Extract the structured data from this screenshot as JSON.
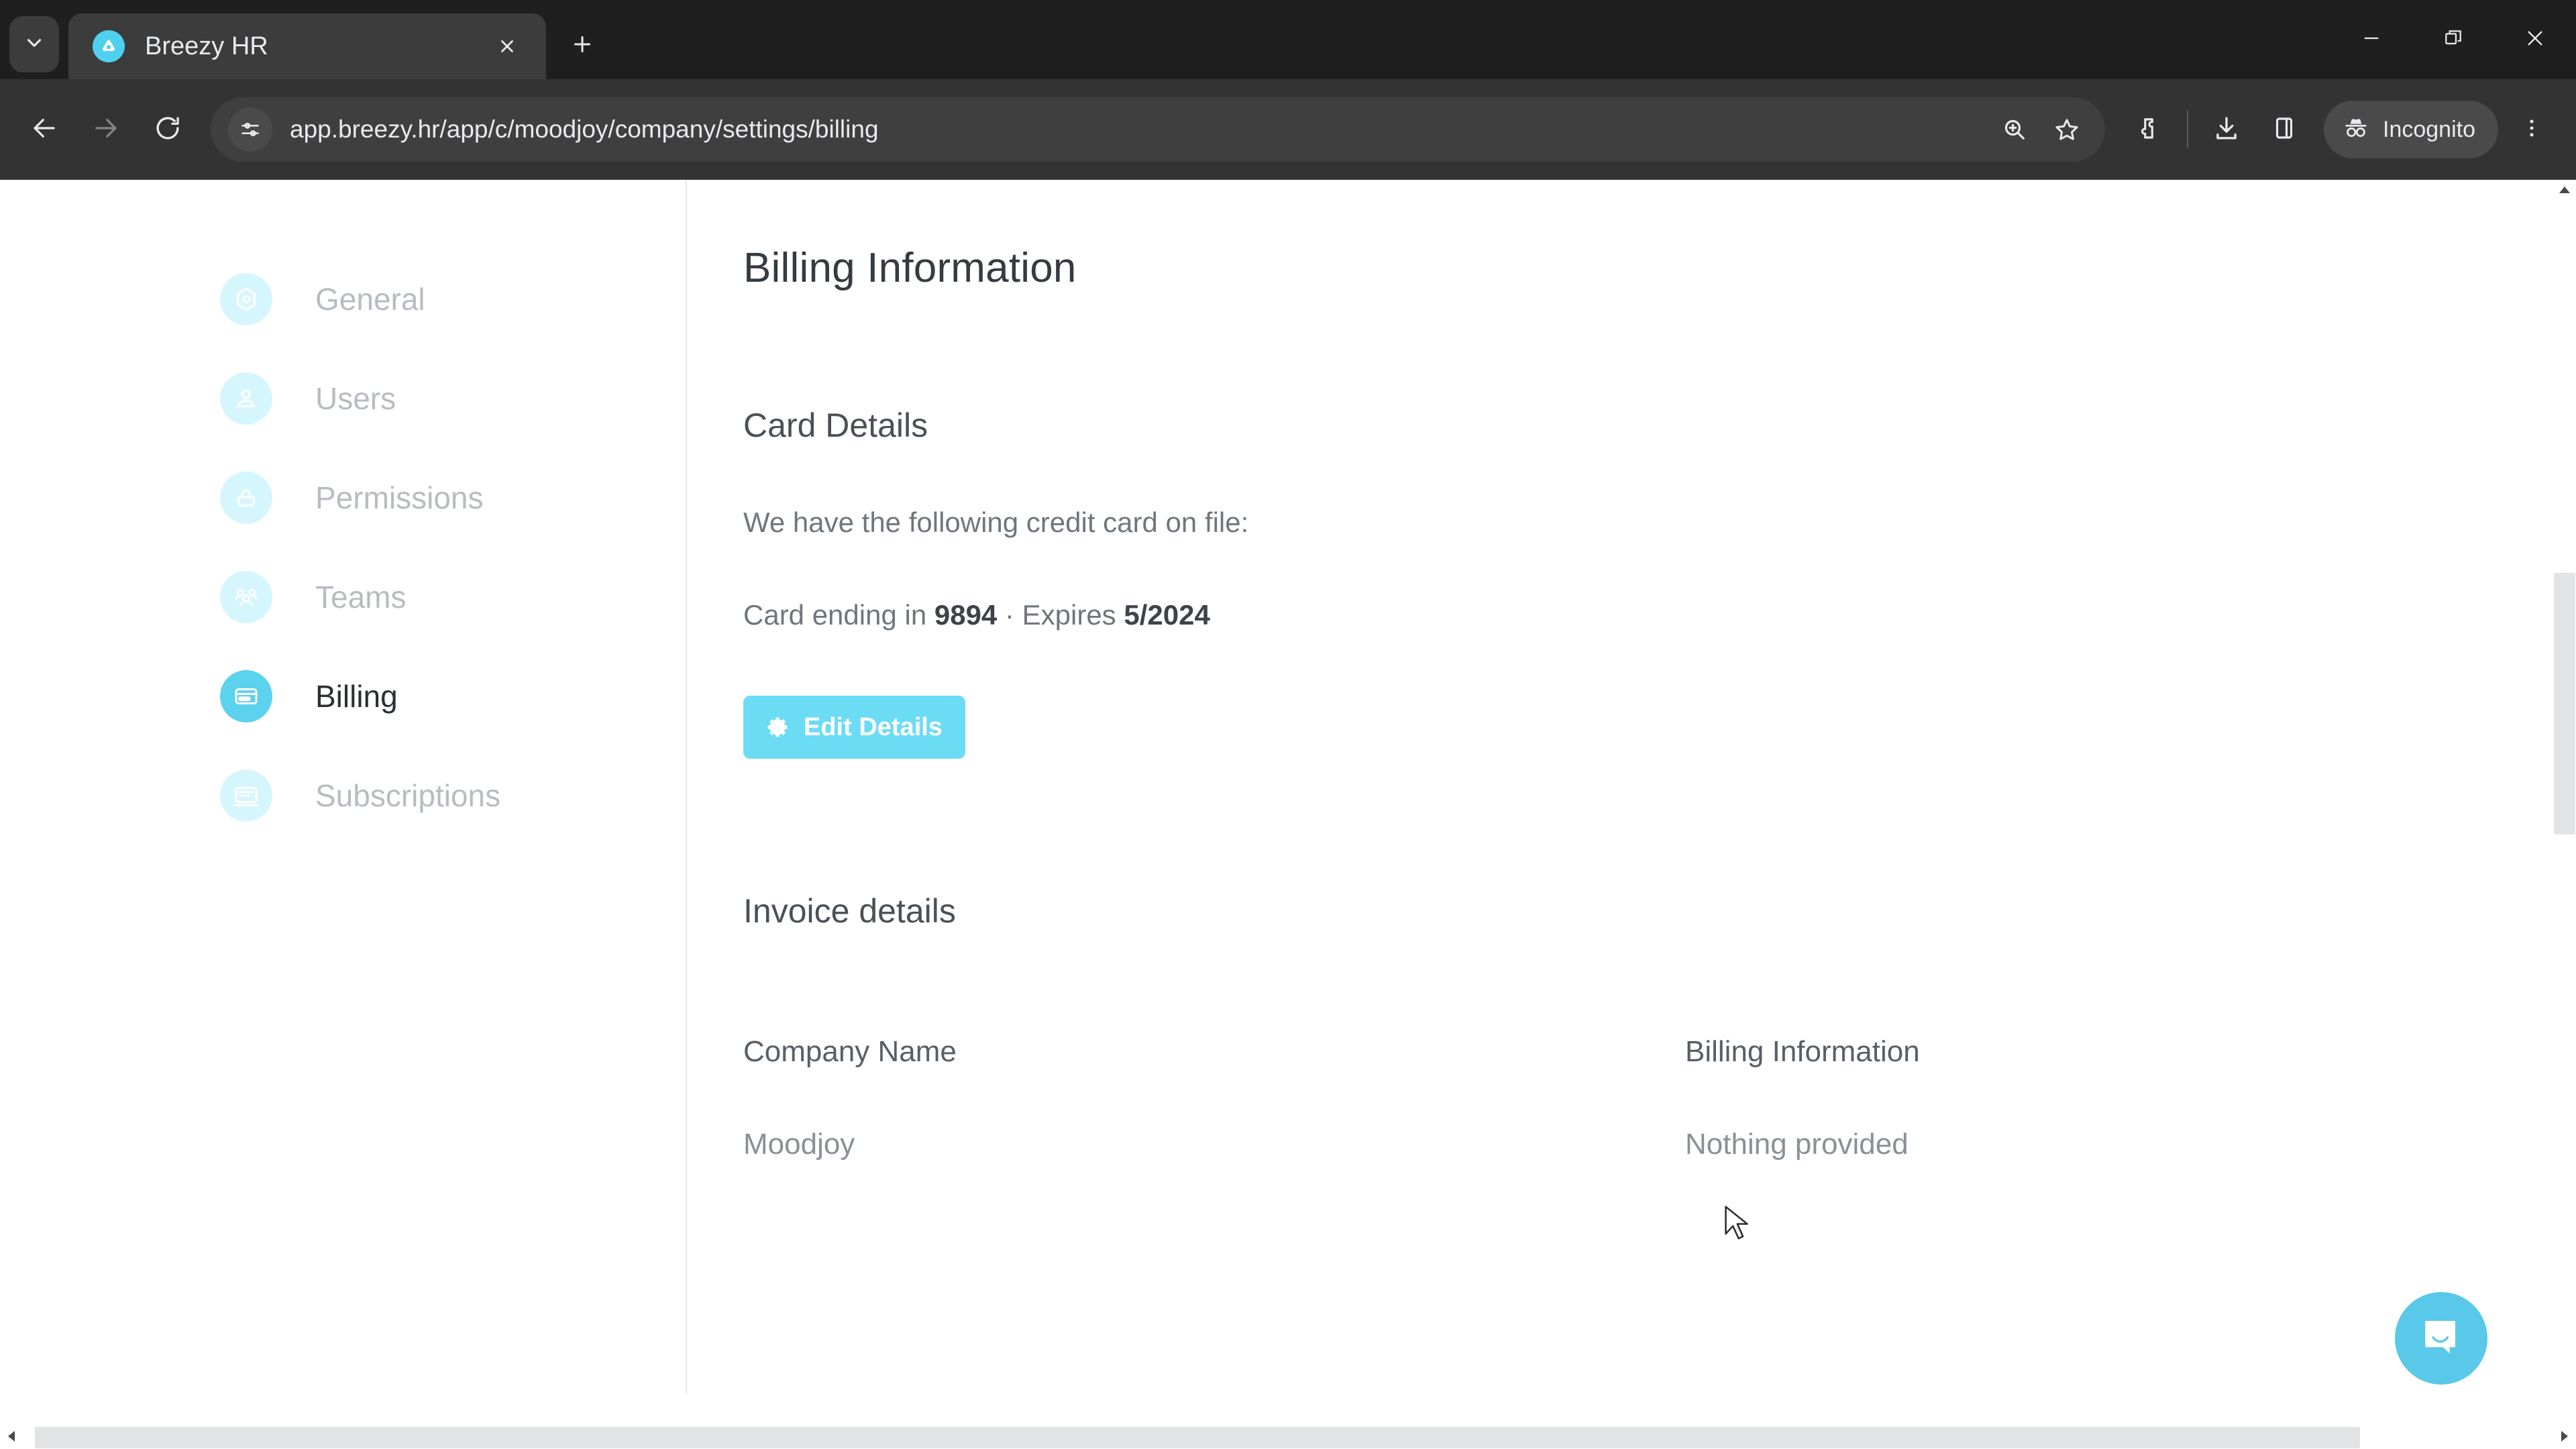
{
  "browser": {
    "tab": {
      "title": "Breezy HR",
      "favicon_name": "breezy-hr-favicon"
    },
    "omnibox": {
      "url": "app.breezy.hr/app/c/moodjoy/company/settings/billing",
      "site_info_icon": "tune-icon"
    },
    "toolbar_icons": {
      "back": "back-arrow-icon",
      "forward": "forward-arrow-icon",
      "reload": "reload-icon",
      "zoom": "zoom-search-icon",
      "bookmark": "star-icon",
      "extensions": "puzzle-extension-icon",
      "downloads": "download-icon",
      "side_panel": "side-panel-icon",
      "menu": "three-dots-menu-icon"
    },
    "incognito": {
      "label": "Incognito",
      "icon": "incognito-hat-icon"
    },
    "window_controls": {
      "minimize": "minimize-icon",
      "restore": "restore-icon",
      "close": "close-icon"
    },
    "new_tab_label": "+",
    "tab_search_icon": "chevron-down-icon"
  },
  "settings_nav": {
    "items": [
      {
        "label": "General",
        "icon": "gear-settings-icon",
        "active": false
      },
      {
        "label": "Users",
        "icon": "user-icon",
        "active": false
      },
      {
        "label": "Permissions",
        "icon": "lock-icon",
        "active": false
      },
      {
        "label": "Teams",
        "icon": "people-group-icon",
        "active": false
      },
      {
        "label": "Billing",
        "icon": "credit-card-icon",
        "active": true
      },
      {
        "label": "Subscriptions",
        "icon": "subscription-icon",
        "active": false
      }
    ]
  },
  "main": {
    "page_title": "Billing Information",
    "card_details": {
      "section_title": "Card Details",
      "intro": "We have the following credit card on file:",
      "card_line_prefix": "Card ending in ",
      "card_last4": "9894",
      "card_line_separator": " · ",
      "expires_prefix": "Expires ",
      "expires_value": "5/2024",
      "edit_button_label": "Edit Details",
      "edit_button_icon": "gear-icon",
      "accent_color": "#6cdcf5"
    },
    "invoice_details": {
      "section_title": "Invoice details",
      "fields": [
        {
          "label": "Company Name",
          "value": "Moodjoy"
        },
        {
          "label": "Billing Information",
          "value": "Nothing provided"
        }
      ]
    }
  },
  "widgets": {
    "intercom_launcher": {
      "icon": "chat-bubble-icon",
      "color": "#5ac8e8"
    }
  },
  "colors": {
    "brand_cyan": "#5bd2ee",
    "brand_cyan_light": "#d6f6fd",
    "chrome_dark": "#333333",
    "tabstrip_dark": "#1f1f1f"
  }
}
